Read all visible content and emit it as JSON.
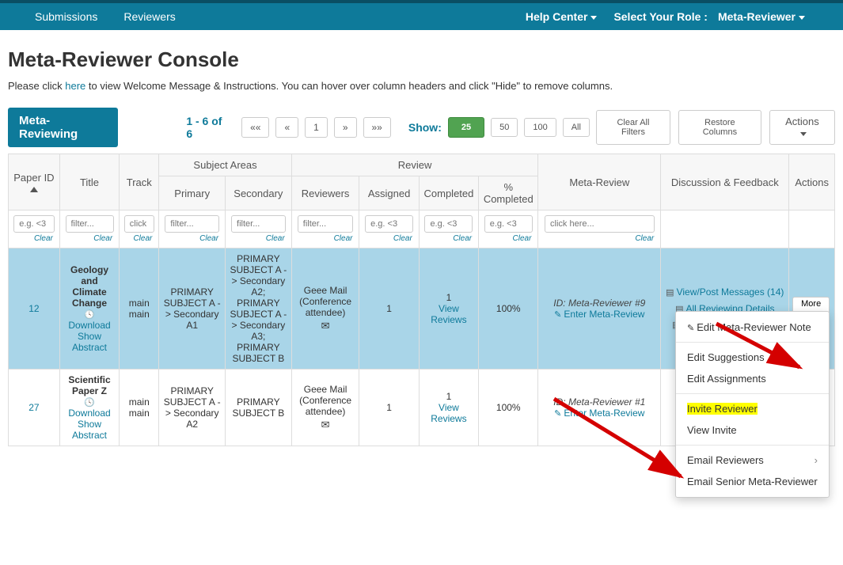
{
  "nav": {
    "submissions": "Submissions",
    "reviewers": "Reviewers",
    "help": "Help Center",
    "selectRoleLbl": "Select Your Role :",
    "role": "Meta-Reviewer"
  },
  "heading": "Meta-Reviewer Console",
  "instr": {
    "pre": "Please click ",
    "link": "here",
    "post": " to view Welcome Message & Instructions. You can hover over column headers and click \"Hide\" to remove columns."
  },
  "toolbar": {
    "tab": "Meta-Reviewing",
    "range": "1 - 6 of 6",
    "pagerFirst": "««",
    "pagerPrev": "«",
    "pagerPage": "1",
    "pagerNext": "»",
    "pagerLast": "»»",
    "showLbl": "Show:",
    "s25": "25",
    "s50": "50",
    "s100": "100",
    "sAll": "All",
    "clear": "Clear All Filters",
    "restore": "Restore Columns",
    "actions": "Actions"
  },
  "cols": {
    "paperId": "Paper ID",
    "title": "Title",
    "track": "Track",
    "subjGroup": "Subject Areas",
    "primary": "Primary",
    "secondary": "Secondary",
    "reviewGroup": "Review",
    "reviewers": "Reviewers",
    "assigned": "Assigned",
    "completed": "Completed",
    "pct": "% Completed",
    "meta": "Meta-Review",
    "discuss": "Discussion & Feedback",
    "actions": "Actions"
  },
  "filters": {
    "paperId": "e.g. <3",
    "title": "filter...",
    "track": "click",
    "primary": "filter...",
    "secondary": "filter...",
    "reviewers": "filter...",
    "assigned": "e.g. <3",
    "completed": "e.g. <3",
    "pct": "e.g. <3",
    "meta": "click here...",
    "clear": "Clear"
  },
  "rows": [
    {
      "id": "12",
      "title": "Geology and Climate Change",
      "download": "Download",
      "show": "Show Abstract",
      "track": "main main",
      "primary": "PRIMARY SUBJECT A -> Secondary A1",
      "secondary": "PRIMARY SUBJECT A -> Secondary A2; PRIMARY SUBJECT A -> Secondary A3; PRIMARY SUBJECT B",
      "reviewer": "Geee Mail (Conference attendee)",
      "assigned": "1",
      "completedN": "1",
      "completedLink": "View Reviews",
      "pct": "100%",
      "metaId": "ID: Meta-Reviewer #9",
      "metaLink": "Enter Meta-Review",
      "d1": "View/Post Messages (14)",
      "d2": "All Reviewing Details",
      "d3": "View Author Feedback",
      "more": "More"
    },
    {
      "id": "27",
      "title": "Scientific Paper Z",
      "download": "Download",
      "show": "Show Abstract",
      "track": "main main",
      "primary": "PRIMARY SUBJECT A -> Secondary A2",
      "secondary": "PRIMARY SUBJECT B",
      "reviewer": "Geee Mail (Conference attendee)",
      "assigned": "1",
      "completedN": "1",
      "completedLink": "View Reviews",
      "pct": "100%",
      "metaId": "ID: Meta-Reviewer #1",
      "metaLink": "Enter Meta-Review"
    }
  ],
  "menu": {
    "editNote": "Edit Meta-Reviewer Note",
    "editSugg": "Edit Suggestions",
    "editAssign": "Edit Assignments",
    "invite": "Invite Reviewer",
    "viewInvite": "View Invite",
    "emailRev": "Email Reviewers",
    "emailSenior": "Email Senior Meta-Reviewer"
  }
}
